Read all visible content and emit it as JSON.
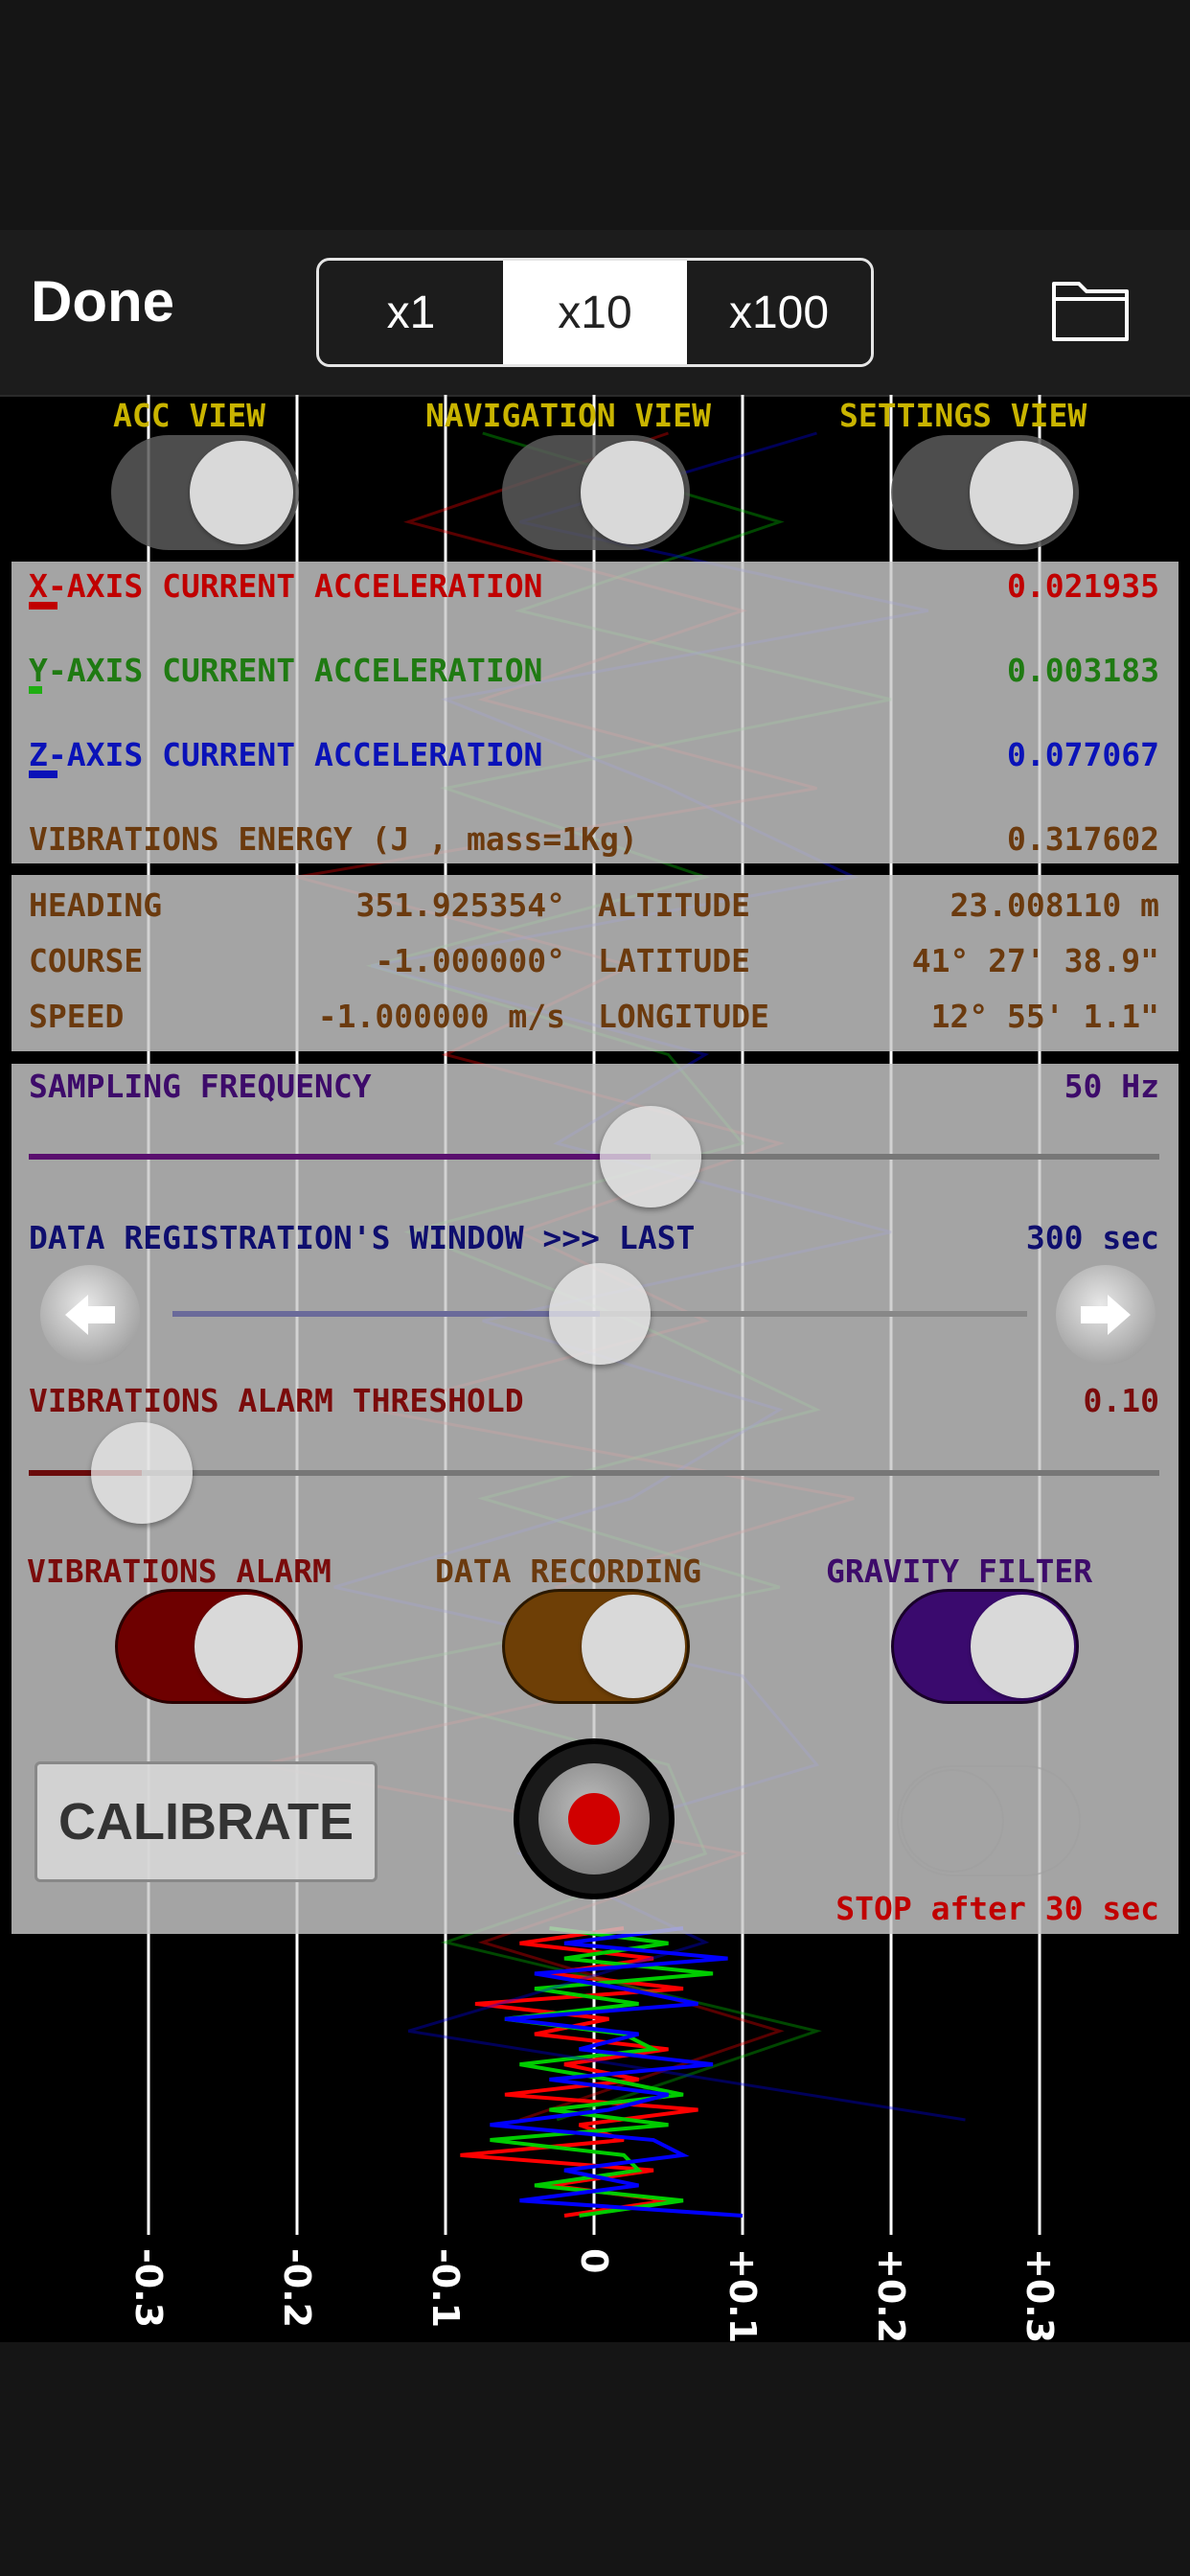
{
  "navbar": {
    "done_label": "Done",
    "zoom_options": [
      "x1",
      "x10",
      "x100"
    ],
    "zoom_selected": "x10",
    "folder_icon": "folder-icon"
  },
  "views": {
    "acc": "ACC VIEW",
    "navigation": "NAVIGATION VIEW",
    "settings": "SETTINGS VIEW"
  },
  "acceleration": {
    "x_label": "X-AXIS CURRENT ACCELERATION",
    "x_value": "0.021935",
    "y_label": "Y-AXIS CURRENT ACCELERATION",
    "y_value": "0.003183",
    "z_label": "Z-AXIS CURRENT ACCELERATION",
    "z_value": "0.077067",
    "energy_label": "VIBRATIONS ENERGY (J , mass=1Kg)",
    "energy_value": "0.317602",
    "x_color": "#c00000",
    "y_color": "#1f7a12",
    "z_color": "#0a12b8"
  },
  "navigation": {
    "heading_label": "HEADING",
    "heading_value": "351.925354°",
    "course_label": "COURSE",
    "course_value": "-1.000000°",
    "speed_label": "SPEED",
    "speed_value": "-1.000000 m/s",
    "altitude_label": "ALTITUDE",
    "altitude_value": "23.008110 m",
    "latitude_label": "LATITUDE",
    "latitude_value": "41° 27' 38.9\"",
    "longitude_label": "LONGITUDE",
    "longitude_value": "12° 55' 1.1\""
  },
  "settings": {
    "sampling_label": "SAMPLING FREQUENCY",
    "sampling_value": "50 Hz",
    "sampling_fraction": 0.55,
    "window_label": "DATA REGISTRATION'S WINDOW >>> LAST",
    "window_value": "300 sec",
    "window_fraction": 0.5,
    "threshold_label": "VIBRATIONS ALARM THRESHOLD",
    "threshold_value": "0.10",
    "threshold_fraction": 0.1,
    "alarm_label": "VIBRATIONS ALARM",
    "recording_label": "DATA RECORDING",
    "gravity_label": "GRAVITY FILTER",
    "alarm_on": true,
    "recording_on": true,
    "gravity_on": true,
    "calibrate_label": "CALIBRATE",
    "stop_label": "STOP after 30 sec"
  },
  "chart_data": {
    "type": "line",
    "orientation": "vertical-time",
    "x_ticks": [
      "-0.3",
      "-0.2",
      "-0.1",
      "0",
      "+0.1",
      "+0.2",
      "+0.3"
    ],
    "xlim": [
      -0.3,
      0.3
    ],
    "grid": true,
    "series": [
      {
        "color": "#ff0000",
        "values": [
          0.02,
          -0.05,
          0.04,
          -0.03,
          0.06,
          -0.08,
          0.01,
          -0.04,
          0.05,
          -0.02,
          0.03,
          -0.06,
          0.07,
          -0.01,
          0.02,
          -0.09,
          0.04,
          -0.03,
          0.05,
          -0.02
        ]
      },
      {
        "color": "#00cc00",
        "values": [
          -0.03,
          0.05,
          -0.02,
          0.08,
          -0.04,
          0.03,
          -0.06,
          0.02,
          0.04,
          -0.05,
          0.01,
          0.06,
          -0.03,
          0.05,
          -0.07,
          0.02,
          0.03,
          -0.04,
          0.06,
          -0.01
        ]
      },
      {
        "color": "#0000ff",
        "values": [
          0.06,
          -0.02,
          0.09,
          -0.04,
          0.02,
          0.07,
          -0.06,
          0.03,
          -0.01,
          0.08,
          -0.03,
          0.05,
          0.01,
          -0.07,
          0.04,
          0.06,
          -0.02,
          0.03,
          -0.05,
          0.1
        ]
      }
    ]
  }
}
